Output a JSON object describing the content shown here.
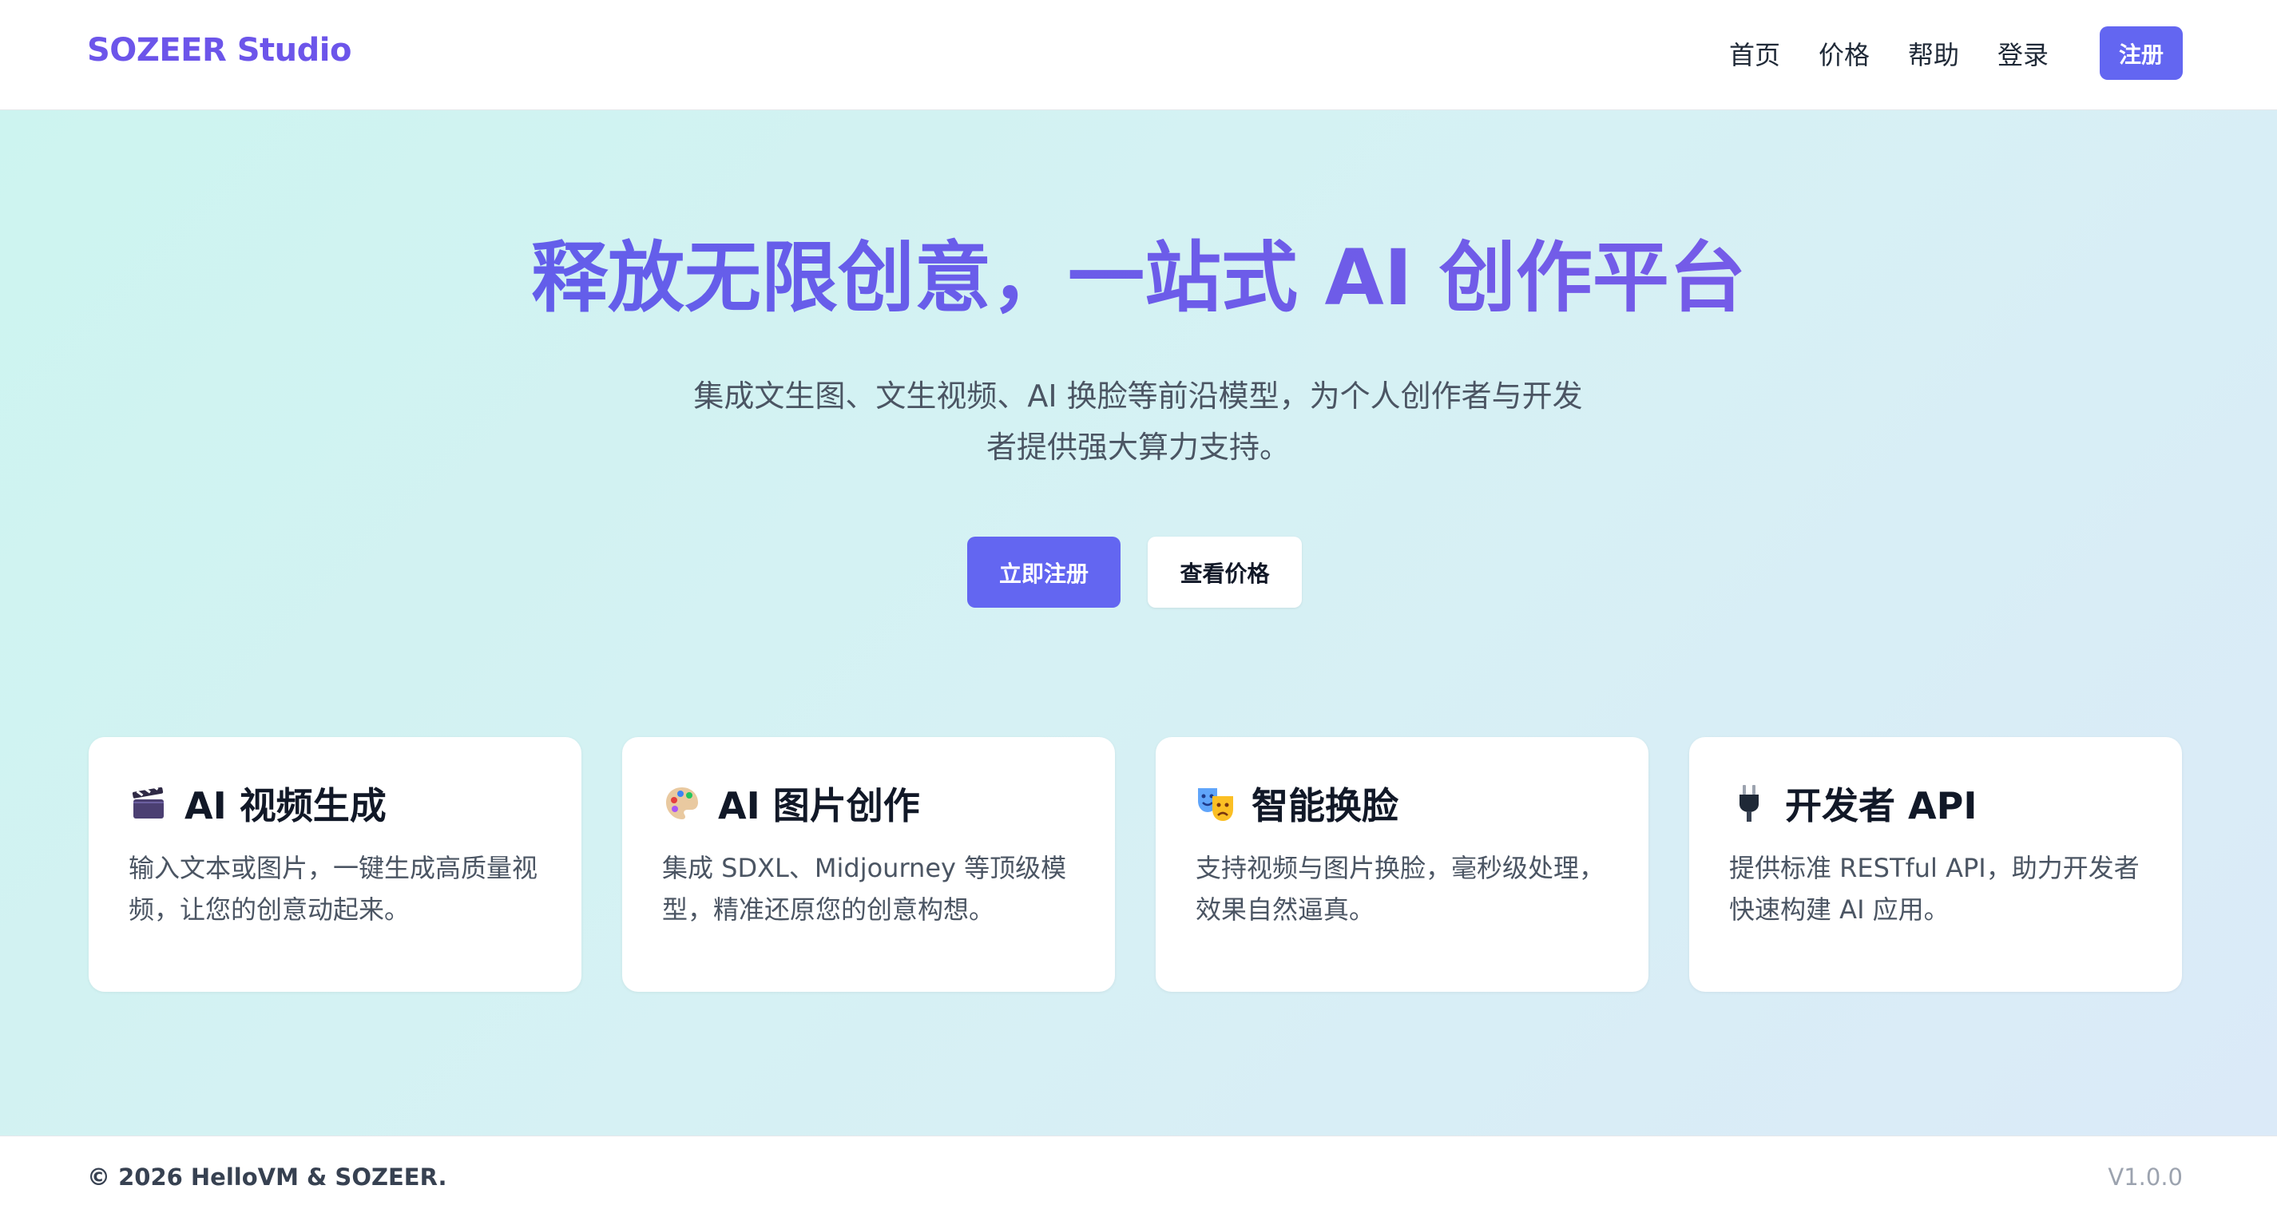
{
  "header": {
    "brand": "SOZEER Studio",
    "nav": [
      {
        "label": "首页"
      },
      {
        "label": "价格"
      },
      {
        "label": "帮助"
      },
      {
        "label": "登录"
      }
    ],
    "signup_label": "注册"
  },
  "hero": {
    "title": "释放无限创意，一站式 AI 创作平台",
    "subtitle_line1": "集成文生图、文生视频、AI 换脸等前沿模型，为个人创作者与开发",
    "subtitle_line2": "者提供强大算力支持。",
    "primary_cta": "立即注册",
    "secondary_cta": "查看价格"
  },
  "features": [
    {
      "icon": "clapperboard-icon",
      "title": "AI 视频生成",
      "desc_line1": "输入文本或图片，一键生成高质量视",
      "desc_line2": "频，让您的创意动起来。"
    },
    {
      "icon": "palette-icon",
      "title": "AI 图片创作",
      "desc_line1": "集成 SDXL、Midjourney 等顶级模",
      "desc_line2": "型，精准还原您的创意构想。"
    },
    {
      "icon": "theater-masks-icon",
      "title": "智能换脸",
      "desc_line1": "支持视频与图片换脸，毫秒级处理，",
      "desc_line2": "效果自然逼真。"
    },
    {
      "icon": "electric-plug-icon",
      "title": "开发者 API",
      "desc_line1": "提供标准 RESTful API，助力开发者",
      "desc_line2": "快速构建 AI 应用。"
    }
  ],
  "footer": {
    "copyright": "© 2026 HelloVM & SOZEER.",
    "version": "V1.0.0"
  },
  "colors": {
    "brand": "#6c55ea",
    "accent": "#6366f1",
    "hero_bg_start": "#cdf4f0",
    "hero_bg_end": "#dbeaf8"
  }
}
